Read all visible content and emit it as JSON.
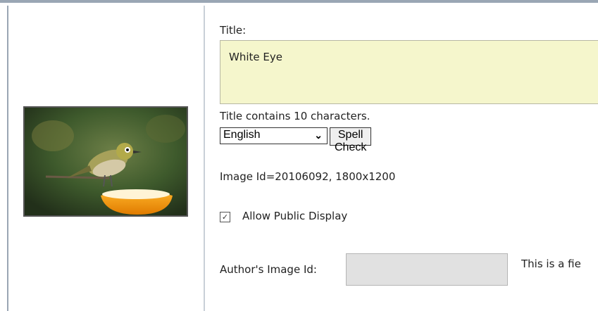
{
  "form": {
    "title_label": "Title:",
    "title_value": "White Eye",
    "char_count_text": "Title contains 10 characters.",
    "language_selected": "English",
    "spell_check_label": "Spell Check",
    "image_id_text": "Image Id=20106092, 1800x1200",
    "allow_public_display_label": "Allow Public Display",
    "allow_public_display_checked": true,
    "author_image_id_label": "Author's Image Id:",
    "author_image_id_value": "",
    "author_note_text": "This is a fie"
  },
  "icons": {
    "checkbox": "check-icon",
    "select": "chevron-down-icon"
  },
  "colors": {
    "title_box_bg": "#f5f6cc",
    "author_input_bg": "#e1e1e1",
    "border": "#9aa6b4"
  }
}
